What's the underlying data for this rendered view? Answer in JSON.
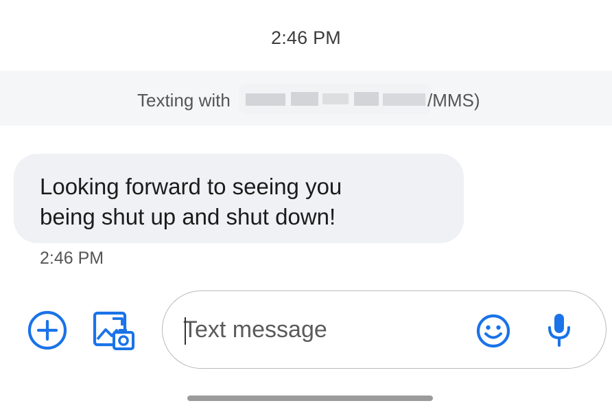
{
  "header": {
    "timestamp": "2:46 PM"
  },
  "banner": {
    "prefix": "Texting with",
    "suffix": "MMS)"
  },
  "conversation": {
    "messages": [
      {
        "lines": [
          "Looking forward to seeing you",
          "being shut up and shut down!"
        ],
        "time": "2:46 PM",
        "direction": "incoming"
      }
    ]
  },
  "composer": {
    "placeholder": "Text message",
    "value": ""
  },
  "icons": {
    "attach": "add-circle-icon",
    "gallery": "gallery-camera-icon",
    "emoji": "emoji-icon",
    "mic": "microphone-icon"
  },
  "colors": {
    "accent": "#1a73e8",
    "bubble": "#eff1f4",
    "banner": "#f5f6f8"
  }
}
